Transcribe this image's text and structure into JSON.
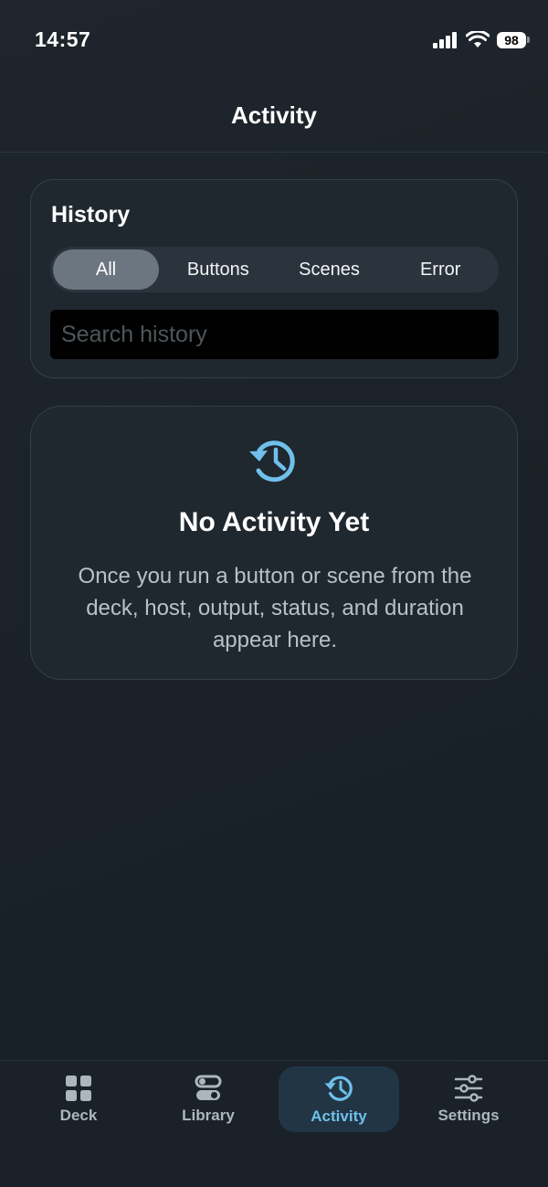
{
  "status_bar": {
    "time": "14:57",
    "battery": "98"
  },
  "header": {
    "title": "Activity"
  },
  "history": {
    "title": "History",
    "segments": [
      "All",
      "Buttons",
      "Scenes",
      "Error"
    ],
    "selected_segment": "All",
    "search_placeholder": "Search history",
    "search_value": ""
  },
  "empty_state": {
    "icon": "history-icon",
    "title": "No Activity Yet",
    "message": "Once you run a button or scene from the deck, host, output, status, and duration appear here."
  },
  "tab_bar": {
    "selected": "Activity",
    "tabs": [
      {
        "label": "Deck",
        "icon": "grid-icon"
      },
      {
        "label": "Library",
        "icon": "toggles-icon"
      },
      {
        "label": "Activity",
        "icon": "history-icon"
      },
      {
        "label": "Settings",
        "icon": "sliders-icon"
      }
    ]
  },
  "colors": {
    "background": "#1b2229",
    "card": "#1f272f",
    "accent": "#6fc0ea",
    "segment_active": "#6c7680"
  }
}
